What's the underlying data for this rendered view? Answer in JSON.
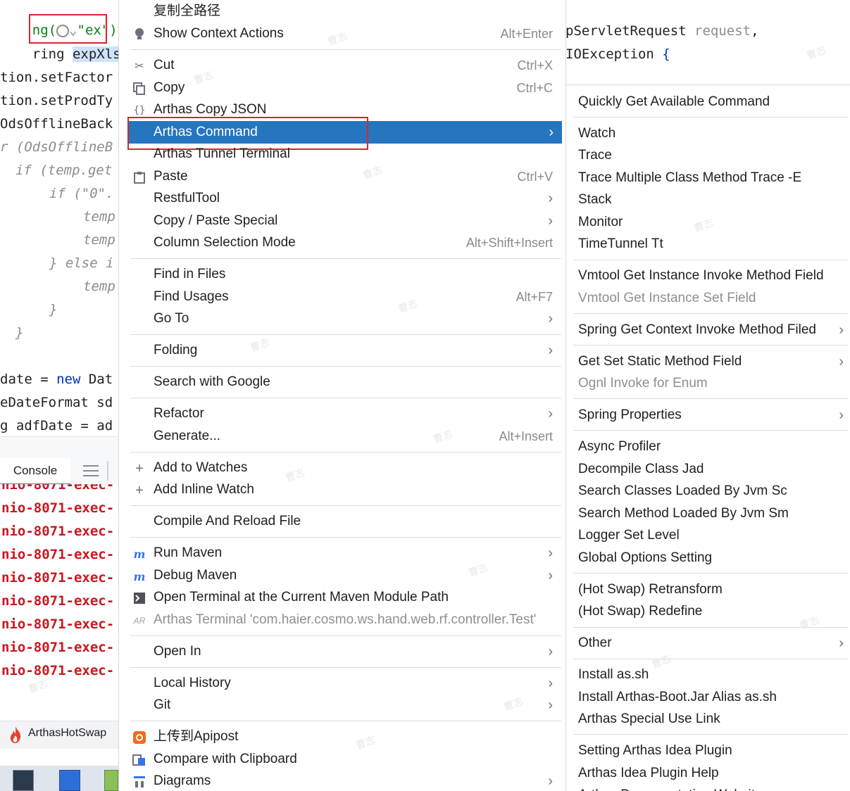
{
  "editor": {
    "line1_part1": "ng(",
    "line1_part2": "\"ex\")",
    "line2_part1": "ring ",
    "line2_selected": "expXlsWat",
    "line3": "tion.setFactor",
    "line4": "tion.setProdTy",
    "line5": "OdsOfflineBack",
    "line6": "r (OdsOfflineB",
    "line7_kw": "if",
    "line7_rest": " (temp.get",
    "line8_kw": "if",
    "line8_str": " (\"0\".",
    "line9": "temp",
    "line10": "temp",
    "line11_kw": "} else",
    "line11_rest": " i",
    "line12": "temp",
    "line13": "}",
    "line14": "}",
    "line15_part1": "date = ",
    "line15_kw": "new",
    "line15_part2": " Dat",
    "line16": "eDateFormat sd",
    "line17": "g adfDate = ad"
  },
  "editor_right": {
    "line1_part1": "pServletRequest ",
    "line1_param": "request",
    "line1_part2": ",",
    "line2_part1": "IOException ",
    "line2_part2": "{"
  },
  "console": {
    "tab_label": "Console",
    "log_prefix": "nio-8071-exec-",
    "hotswap_label": "ArthasHotSwap"
  },
  "menu": {
    "items": [
      {
        "label": "复制全路径",
        "shortcut": "",
        "icon": ""
      },
      {
        "label": "Show Context Actions",
        "shortcut": "Alt+Enter",
        "icon": "bulb-icon"
      },
      {
        "label": "Cut",
        "shortcut": "Ctrl+X",
        "icon": "scissors-icon"
      },
      {
        "label": "Copy",
        "shortcut": "Ctrl+C",
        "icon": "copy-icon"
      },
      {
        "label": "Arthas Copy JSON",
        "shortcut": "",
        "icon": "braces-icon"
      },
      {
        "label": "Arthas Command",
        "shortcut": "",
        "icon": ""
      },
      {
        "label": "Arthas Tunnel Terminal",
        "shortcut": "",
        "icon": ""
      },
      {
        "label": "Paste",
        "shortcut": "Ctrl+V",
        "icon": "clipboard-icon"
      },
      {
        "label": "RestfulTool",
        "shortcut": "",
        "icon": ""
      },
      {
        "label": "Copy / Paste Special",
        "shortcut": "",
        "icon": ""
      },
      {
        "label": "Column Selection Mode",
        "shortcut": "Alt+Shift+Insert",
        "icon": ""
      },
      {
        "label": "Find in Files",
        "shortcut": "",
        "icon": ""
      },
      {
        "label": "Find Usages",
        "shortcut": "Alt+F7",
        "icon": ""
      },
      {
        "label": "Go To",
        "shortcut": "",
        "icon": ""
      },
      {
        "label": "Folding",
        "shortcut": "",
        "icon": ""
      },
      {
        "label": "Search with Google",
        "shortcut": "",
        "icon": ""
      },
      {
        "label": "Refactor",
        "shortcut": "",
        "icon": ""
      },
      {
        "label": "Generate...",
        "shortcut": "Alt+Insert",
        "icon": ""
      },
      {
        "label": "Add to Watches",
        "shortcut": "",
        "icon": "add-watch-icon"
      },
      {
        "label": "Add Inline Watch",
        "shortcut": "",
        "icon": "add-inline-watch-icon"
      },
      {
        "label": "Compile And Reload File",
        "shortcut": "",
        "icon": ""
      },
      {
        "label": "Run Maven",
        "shortcut": "",
        "icon": "maven-run-icon"
      },
      {
        "label": "Debug Maven",
        "shortcut": "",
        "icon": "maven-debug-icon"
      },
      {
        "label": "Open Terminal at the Current Maven Module Path",
        "shortcut": "",
        "icon": "terminal-icon"
      },
      {
        "label": "Arthas Terminal 'com.haier.cosmo.ws.hand.web.rf.controller.Test'",
        "shortcut": "",
        "icon": "arthas-terminal-icon"
      },
      {
        "label": "Open In",
        "shortcut": "",
        "icon": ""
      },
      {
        "label": "Local History",
        "shortcut": "",
        "icon": ""
      },
      {
        "label": "Git",
        "shortcut": "",
        "icon": ""
      },
      {
        "label": "上传到Apipost",
        "shortcut": "",
        "icon": "apipost-icon"
      },
      {
        "label": "Compare with Clipboard",
        "shortcut": "",
        "icon": "compare-icon"
      },
      {
        "label": "Diagrams",
        "shortcut": "",
        "icon": "diagram-icon"
      }
    ]
  },
  "submenu": {
    "items": [
      {
        "label": "Quickly Get Available Command"
      },
      {
        "label": "Watch"
      },
      {
        "label": "Trace"
      },
      {
        "label": "Trace Multiple Class Method Trace -E"
      },
      {
        "label": "Stack"
      },
      {
        "label": "Monitor"
      },
      {
        "label": "TimeTunnel Tt"
      },
      {
        "label": "Vmtool Get Instance Invoke Method Field"
      },
      {
        "label": "Vmtool Get Instance Set Field"
      },
      {
        "label": "Spring Get Context Invoke Method Filed"
      },
      {
        "label": "Get Set Static Method Field"
      },
      {
        "label": "Ognl Invoke for Enum"
      },
      {
        "label": "Spring Properties"
      },
      {
        "label": "Async Profiler"
      },
      {
        "label": "Decompile Class Jad"
      },
      {
        "label": "Search Classes Loaded By Jvm Sc"
      },
      {
        "label": "Search Method Loaded By Jvm Sm"
      },
      {
        "label": "Logger Set Level"
      },
      {
        "label": "Global Options Setting"
      },
      {
        "label": "(Hot Swap) Retransform"
      },
      {
        "label": "(Hot Swap) Redefine"
      },
      {
        "label": "Other"
      },
      {
        "label": "Install as.sh"
      },
      {
        "label": "Install Arthas-Boot.Jar Alias as.sh"
      },
      {
        "label": "Arthas Special Use Link"
      },
      {
        "label": "Setting Arthas Idea Plugin"
      },
      {
        "label": "Arthas Idea Plugin Help"
      },
      {
        "label": "Arthas Documentation Website"
      }
    ]
  },
  "watermark": "曹志",
  "colors": {
    "highlight": "#2675bf",
    "annotation_box": "#e0202e",
    "log_text": "#c8171e"
  }
}
